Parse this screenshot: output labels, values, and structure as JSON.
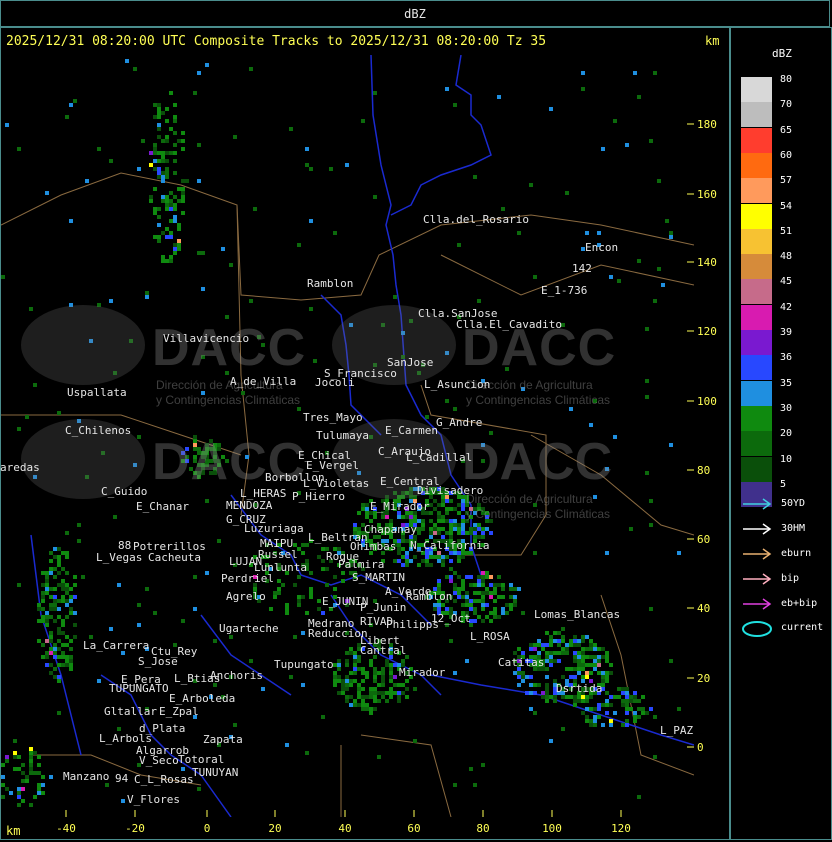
{
  "title": "dBZ",
  "header": "2025/12/31 08:20:00 UTC Composite Tracks to 2025/12/31 08:20:00 Tz 35",
  "km_label": "km",
  "y_ticks": [
    "180",
    "160",
    "140",
    "120",
    "100",
    "80",
    "60",
    "40",
    "20",
    "0"
  ],
  "x_ticks": [
    "-40",
    "-20",
    "0",
    "20",
    "40",
    "60",
    "80",
    "100",
    "120"
  ],
  "watermark": {
    "name": "DACC",
    "subtitle_1": "Dirección de Agricultura",
    "subtitle_2": "y Contingencias Climáticas"
  },
  "places": [
    {
      "id": "clla-del-rosario",
      "label": "Clla.del_Rosario"
    },
    {
      "id": "encon",
      "label": "Encon"
    },
    {
      "id": "road-142",
      "label": "142"
    },
    {
      "id": "e-1-736",
      "label": "E_1-736"
    },
    {
      "id": "ramblon-n",
      "label": "Ramblon"
    },
    {
      "id": "clla-sanjose",
      "label": "Clla.SanJose"
    },
    {
      "id": "clla-el-cavadito",
      "label": "Clla.El_Cavadito"
    },
    {
      "id": "villavicencio",
      "label": "Villavicencio"
    },
    {
      "id": "s-francisco",
      "label": "S_Francisco"
    },
    {
      "id": "sanjose",
      "label": "SanJose"
    },
    {
      "id": "a-de-villa",
      "label": "A_de_Villa"
    },
    {
      "id": "jocoli",
      "label": "Jocoli"
    },
    {
      "id": "l-asuncion",
      "label": "L_Asuncion"
    },
    {
      "id": "uspallata",
      "label": "Uspallata"
    },
    {
      "id": "tres-mayo",
      "label": "Tres_Mayo"
    },
    {
      "id": "g-andre",
      "label": "G_Andre"
    },
    {
      "id": "tulumaya",
      "label": "Tulumaya"
    },
    {
      "id": "e-carmen",
      "label": "E_Carmen"
    },
    {
      "id": "c-chilenos",
      "label": "C_Chilenos"
    },
    {
      "id": "c-araujo",
      "label": "C_Araujo"
    },
    {
      "id": "e-chical",
      "label": "E_Chical"
    },
    {
      "id": "l-cadillal",
      "label": "L_Cadillal"
    },
    {
      "id": "paredas",
      "label": "aredas"
    },
    {
      "id": "e-vergel",
      "label": "E_Vergel"
    },
    {
      "id": "borbollon",
      "label": "Borbollon"
    },
    {
      "id": "l-violetas",
      "label": "L_Violetas"
    },
    {
      "id": "e-central",
      "label": "E_Central"
    },
    {
      "id": "divisadero",
      "label": "Divisadero"
    },
    {
      "id": "c-guido",
      "label": "C_Guido"
    },
    {
      "id": "l-heras",
      "label": "L_HERAS"
    },
    {
      "id": "p-hierro",
      "label": "P_Hierro"
    },
    {
      "id": "e-chanar",
      "label": "E_Chanar"
    },
    {
      "id": "mendoza",
      "label": "MENDOZA"
    },
    {
      "id": "e-mirador",
      "label": "E_Mirador"
    },
    {
      "id": "g-cruz",
      "label": "G_CRUZ"
    },
    {
      "id": "luzuriaga",
      "label": "Luzuriaga"
    },
    {
      "id": "chapanay",
      "label": "Chapanay"
    },
    {
      "id": "l-beltran",
      "label": "L_Beltran"
    },
    {
      "id": "n-california",
      "label": "N_California"
    },
    {
      "id": "road-88",
      "label": "88"
    },
    {
      "id": "potrerillos",
      "label": "Potrerillos"
    },
    {
      "id": "maipu",
      "label": "MAIPU"
    },
    {
      "id": "ohimbas",
      "label": "Ohimbas"
    },
    {
      "id": "l-vegas",
      "label": "L_Vegas"
    },
    {
      "id": "cacheuta",
      "label": "Cacheuta"
    },
    {
      "id": "russel",
      "label": "Russel"
    },
    {
      "id": "roque",
      "label": "Roque"
    },
    {
      "id": "lujan",
      "label": "LUJAN"
    },
    {
      "id": "lunlunta",
      "label": "Lunlunta"
    },
    {
      "id": "palmira",
      "label": "Palmira"
    },
    {
      "id": "perdriel",
      "label": "Perdriel"
    },
    {
      "id": "s-martin",
      "label": "S_MARTIN"
    },
    {
      "id": "a-verde",
      "label": "A_Verde"
    },
    {
      "id": "ramblon-s",
      "label": "Ramblon"
    },
    {
      "id": "agrelo",
      "label": "Agrelo"
    },
    {
      "id": "e-junin",
      "label": "E_JUNIN"
    },
    {
      "id": "ugarteche",
      "label": "Ugarteche"
    },
    {
      "id": "rivad",
      "label": "RIVAD"
    },
    {
      "id": "philipps",
      "label": "Philipps"
    },
    {
      "id": "12-oct",
      "label": "12_Oct"
    },
    {
      "id": "lomas-blancas",
      "label": "Lomas_Blancas"
    },
    {
      "id": "medrano",
      "label": "Medrano"
    },
    {
      "id": "reduccion",
      "label": "Reduccion"
    },
    {
      "id": "libert",
      "label": "Libert"
    },
    {
      "id": "la-paz-rosa",
      "label": "L_ROSA"
    },
    {
      "id": "la-carrera",
      "label": "La_Carrera"
    },
    {
      "id": "c-del-rey",
      "label": "Ctu_Rey"
    },
    {
      "id": "s-jose",
      "label": "S_Jose"
    },
    {
      "id": "cantral",
      "label": "Cantral"
    },
    {
      "id": "tupungato-label",
      "label": "Tupungato"
    },
    {
      "id": "catitas",
      "label": "Catitas"
    },
    {
      "id": "e-pera",
      "label": "E_Pera"
    },
    {
      "id": "l-btias",
      "label": "L_Btias"
    },
    {
      "id": "anchoris",
      "label": "Anchoris"
    },
    {
      "id": "tupungato",
      "label": "TUPUNGATO"
    },
    {
      "id": "mirador",
      "label": "Mirador"
    },
    {
      "id": "e-arboleda",
      "label": "E_Arboleda"
    },
    {
      "id": "desaguadero",
      "label": "Dsrtida"
    },
    {
      "id": "gltallar",
      "label": "Gltallar"
    },
    {
      "id": "e-zpal",
      "label": "E_Zpal"
    },
    {
      "id": "d-plata",
      "label": "d_Plata"
    },
    {
      "id": "l-paz",
      "label": "L_PAZ"
    },
    {
      "id": "l-arbols",
      "label": "L_Arbols"
    },
    {
      "id": "zapata",
      "label": "Zapata"
    },
    {
      "id": "algarrob",
      "label": "Algarrob"
    },
    {
      "id": "v-seco",
      "label": "V_Seco"
    },
    {
      "id": "totoral",
      "label": "Totoral"
    },
    {
      "id": "tunuyan",
      "label": "TUNUYAN"
    },
    {
      "id": "manzano",
      "label": "Manzano"
    },
    {
      "id": "road-94",
      "label": "94"
    },
    {
      "id": "c-l-rosas",
      "label": "C_L_Rosas"
    },
    {
      "id": "v-flores",
      "label": "V_Flores"
    },
    {
      "id": "e-elv",
      "label": "P_Junin"
    }
  ],
  "legend": {
    "title": "dBZ",
    "scale": [
      {
        "value": "80",
        "color": "#d8d8d8"
      },
      {
        "value": "70",
        "color": "#bdbdbd"
      },
      {
        "value": "65",
        "color": "#ff3d2e"
      },
      {
        "value": "60",
        "color": "#ff6a10"
      },
      {
        "value": "57",
        "color": "#ff9a5c"
      },
      {
        "value": "54",
        "color": "#ffff00"
      },
      {
        "value": "51",
        "color": "#f7c232"
      },
      {
        "value": "48",
        "color": "#d68b3a"
      },
      {
        "value": "45",
        "color": "#c66b8a"
      },
      {
        "value": "42",
        "color": "#d81bb0"
      },
      {
        "value": "39",
        "color": "#7a19d0"
      },
      {
        "value": "36",
        "color": "#2848ff"
      },
      {
        "value": "35",
        "color": "#1f8fe0"
      },
      {
        "value": "30",
        "color": "#0f8a0f"
      },
      {
        "value": "20",
        "color": "#0c6a0c"
      },
      {
        "value": "10",
        "color": "#0a4f0a"
      },
      {
        "value": "5",
        "color": "#40308c"
      }
    ],
    "tracks": [
      {
        "label": "50YD",
        "color": "#40d0e0"
      },
      {
        "label": "30HM",
        "color": "#ffffff"
      },
      {
        "label": "eburn",
        "color": "#e8b070"
      },
      {
        "label": "bip",
        "color": "#ffb0c0"
      },
      {
        "label": "eb+bip",
        "color": "#e040e0"
      },
      {
        "label": "current",
        "color": "#20e0e0"
      }
    ]
  }
}
